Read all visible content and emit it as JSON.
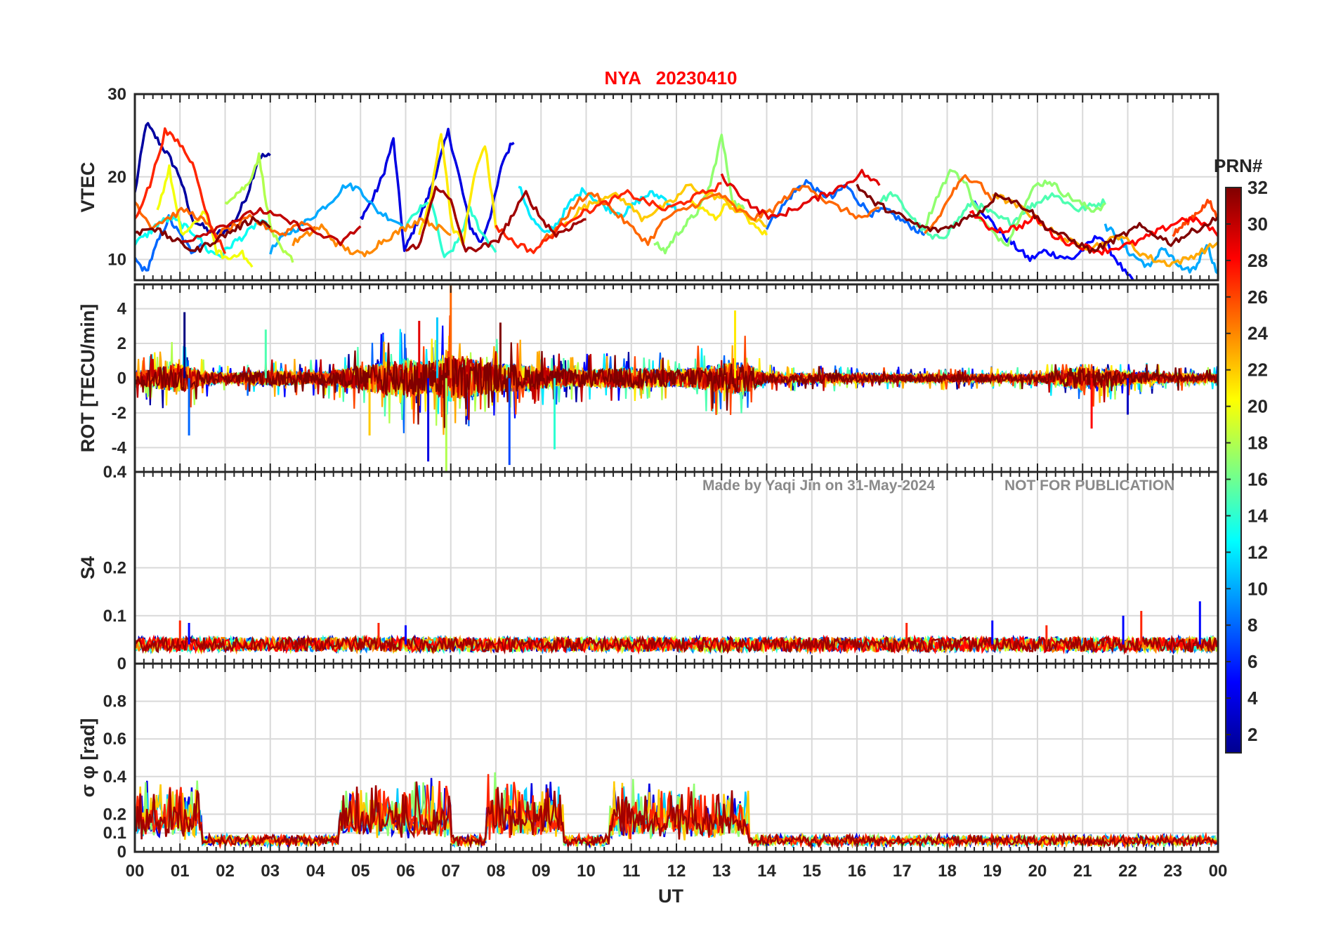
{
  "chart_data": {
    "type": "line",
    "title": "NYA   20230410",
    "watermark": [
      "Made by Yaqi Jin on 31-May-2024",
      "NOT FOR PUBLICATION"
    ],
    "x_axis": {
      "label": "UT",
      "range_hours": [
        0,
        24
      ],
      "tick_labels": [
        "00",
        "01",
        "02",
        "03",
        "04",
        "05",
        "06",
        "07",
        "08",
        "09",
        "10",
        "11",
        "12",
        "13",
        "14",
        "15",
        "16",
        "17",
        "18",
        "19",
        "20",
        "21",
        "22",
        "23",
        "00"
      ]
    },
    "grid": true,
    "colormap": "jet",
    "colorbar": {
      "title": "PRN#",
      "range": [
        1,
        32
      ],
      "tick_labels": [
        "2",
        "4",
        "6",
        "8",
        "10",
        "12",
        "14",
        "16",
        "18",
        "20",
        "22",
        "24",
        "26",
        "28",
        "30",
        "32"
      ],
      "ticks": [
        2,
        4,
        6,
        8,
        10,
        12,
        14,
        16,
        18,
        20,
        22,
        24,
        26,
        28,
        30,
        32
      ]
    },
    "panels": [
      {
        "name": "vtec",
        "ylabel": "VTEC",
        "ylim": [
          7.5,
          30
        ],
        "ytick_labels": [
          "10",
          "20",
          "30"
        ],
        "yticks": [
          10,
          20,
          30
        ],
        "series": [
          {
            "prn": 2,
            "start_h": 0.0,
            "end_h": 3.0,
            "values": [
              18,
              26.5,
              24.5,
              22.5,
              20,
              15,
              14,
              13,
              13.5,
              15,
              18,
              22.5,
              22.5
            ]
          },
          {
            "prn": 4,
            "start_h": 5.0,
            "end_h": 8.4,
            "values": [
              15,
              17,
              20,
              24.5,
              11,
              14,
              17,
              21,
              25.5,
              20,
              14,
              12,
              16,
              22,
              24.5
            ]
          },
          {
            "prn": 5,
            "start_h": 18.6,
            "end_h": 22.3,
            "values": [
              17,
              15,
              13,
              11.5,
              10,
              11,
              10.5,
              10,
              11.5,
              13,
              10.5,
              8,
              6.5
            ]
          },
          {
            "prn": 8,
            "start_h": 0.0,
            "end_h": 1.5,
            "values": [
              10,
              8.5,
              12,
              15,
              13,
              11,
              12
            ]
          },
          {
            "prn": 8,
            "start_h": 14.0,
            "end_h": 17.5,
            "values": [
              14,
              16,
              18,
              19.5,
              18,
              17.5,
              19,
              17,
              15.5,
              16,
              15,
              14,
              13
            ]
          },
          {
            "prn": 10,
            "start_h": 3.0,
            "end_h": 6.0,
            "values": [
              11,
              13,
              14,
              15.5,
              17,
              19,
              18.5,
              16,
              15,
              14
            ]
          },
          {
            "prn": 10,
            "start_h": 21.5,
            "end_h": 24.0,
            "values": [
              14,
              13,
              11,
              10,
              9,
              11.5,
              10,
              8.5,
              9,
              12,
              8
            ]
          },
          {
            "prn": 12,
            "start_h": 8.5,
            "end_h": 12.0,
            "values": [
              19,
              15,
              13,
              14.5,
              17,
              18.5,
              17,
              16,
              15.5,
              17,
              18,
              17.5,
              16
            ]
          },
          {
            "prn": 13,
            "start_h": 0.0,
            "end_h": 3.0,
            "values": [
              12,
              13,
              14.5,
              15,
              14,
              13,
              11,
              10.5,
              12,
              13,
              14.5,
              14
            ]
          },
          {
            "prn": 14,
            "start_h": 6.0,
            "end_h": 8.0,
            "values": [
              14,
              16,
              17,
              10,
              12,
              16,
              13,
              11
            ]
          },
          {
            "prn": 15,
            "start_h": 16.5,
            "end_h": 21.5,
            "values": [
              17,
              18,
              16,
              14,
              12.5,
              13,
              15,
              17,
              16,
              15,
              14.5,
              16,
              17,
              18,
              17,
              16,
              16.5,
              17
            ]
          },
          {
            "prn": 17,
            "start_h": 17.5,
            "end_h": 21.5,
            "values": [
              14,
              18,
              21,
              19,
              15,
              13,
              12,
              16,
              19,
              19.5,
              18,
              17,
              16,
              16.5
            ]
          },
          {
            "prn": 17,
            "start_h": 11.5,
            "end_h": 13.5,
            "values": [
              12,
              11,
              13,
              14.5,
              16,
              19,
              25,
              17,
              16
            ]
          },
          {
            "prn": 18,
            "start_h": 2.0,
            "end_h": 3.5,
            "values": [
              17,
              18,
              19,
              22.5,
              14,
              11,
              10
            ]
          },
          {
            "prn": 20,
            "start_h": 0.5,
            "end_h": 2.6,
            "values": [
              16,
              21,
              13,
              14,
              16,
              11,
              10,
              11,
              9
            ]
          },
          {
            "prn": 21,
            "start_h": 6.3,
            "end_h": 8.0,
            "values": [
              13,
              17,
              25.5,
              14,
              12,
              20,
              24,
              14
            ]
          },
          {
            "prn": 21,
            "start_h": 12.3,
            "end_h": 14.0,
            "values": [
              17,
              16,
              15,
              17,
              16,
              14,
              13
            ]
          },
          {
            "prn": 22,
            "start_h": 9.5,
            "end_h": 14.0,
            "values": [
              14,
              16,
              17,
              18,
              17,
              15,
              16,
              17,
              19,
              18,
              17.5,
              16,
              15,
              14
            ]
          },
          {
            "prn": 23,
            "start_h": 19.0,
            "end_h": 24.0,
            "values": [
              18,
              17,
              16,
              14.5,
              13,
              12,
              11.5,
              12,
              13,
              11,
              10,
              9.5,
              10,
              11,
              12
            ]
          },
          {
            "prn": 24,
            "start_h": 3.5,
            "end_h": 7.0,
            "values": [
              12,
              13,
              14,
              12,
              11,
              10.5,
              12,
              13,
              14,
              15,
              14,
              13
            ]
          },
          {
            "prn": 25,
            "start_h": 0.0,
            "end_h": 4.0,
            "values": [
              17,
              14,
              15,
              16,
              15,
              13,
              14,
              15,
              14,
              13,
              14.5,
              14
            ]
          },
          {
            "prn": 25,
            "start_h": 9.0,
            "end_h": 16.5,
            "values": [
              12,
              14,
              17,
              18,
              16,
              14,
              12,
              15,
              16,
              17,
              18,
              16,
              15,
              16,
              18,
              19,
              17,
              16,
              15,
              16
            ]
          },
          {
            "prn": 25,
            "start_h": 17.5,
            "end_h": 19.0,
            "values": [
              13,
              15,
              18,
              20,
              19.5,
              17
            ]
          },
          {
            "prn": 26,
            "start_h": 23.0,
            "end_h": 24.0,
            "values": [
              13,
              14,
              15,
              16,
              17,
              15
            ]
          },
          {
            "prn": 27,
            "start_h": 0.0,
            "end_h": 2.0,
            "values": [
              15,
              19,
              25.5,
              24,
              21,
              14,
              11
            ]
          },
          {
            "prn": 27,
            "start_h": 8.0,
            "end_h": 13.0,
            "values": [
              14,
              12,
              11,
              13,
              15,
              16,
              17,
              18,
              17,
              16,
              17,
              18,
              19
            ]
          },
          {
            "prn": 28,
            "start_h": 18.5,
            "end_h": 24.0,
            "values": [
              16,
              14,
              13.5,
              14,
              15,
              13,
              12,
              11.5,
              11,
              11.5,
              12,
              13,
              14,
              15,
              14.5,
              13
            ]
          },
          {
            "prn": 29,
            "start_h": 13.0,
            "end_h": 16.5,
            "values": [
              20,
              18,
              16,
              15,
              16,
              17,
              18,
              19,
              20.5,
              19
            ]
          },
          {
            "prn": 30,
            "start_h": 1.0,
            "end_h": 5.0,
            "values": [
              12,
              13,
              14,
              15,
              16,
              15,
              14,
              13,
              12,
              14
            ]
          },
          {
            "prn": 31,
            "start_h": 6.0,
            "end_h": 10.0,
            "values": [
              11,
              12,
              19,
              17,
              11,
              11.5,
              12,
              15,
              18,
              15,
              13,
              14,
              15
            ]
          },
          {
            "prn": 32,
            "start_h": 0.0,
            "end_h": 3.0,
            "values": [
              13,
              14,
              13,
              12,
              11,
              12,
              13,
              14,
              15,
              14
            ]
          },
          {
            "prn": 32,
            "start_h": 16.0,
            "end_h": 24.0,
            "values": [
              19,
              17,
              16,
              15,
              14,
              13.5,
              14,
              15,
              16,
              18,
              17,
              16,
              14,
              13,
              12,
              11,
              12,
              13,
              14,
              13,
              12,
              13,
              14,
              15
            ]
          }
        ]
      },
      {
        "name": "rot",
        "ylabel": "ROT [TECU/min]",
        "ylim": [
          -5.4,
          5.4
        ],
        "ytick_labels": [
          "-4",
          "-2",
          "0",
          "2",
          "4"
        ],
        "yticks": [
          -4,
          -2,
          0,
          2,
          4
        ],
        "envelope": {
          "hours": [
            0,
            0.5,
            1,
            1.5,
            2,
            3,
            4,
            5,
            6,
            6.5,
            7,
            8,
            8.5,
            9,
            10,
            11,
            12,
            13,
            13.5,
            14,
            15,
            16,
            17,
            18,
            19,
            20,
            21,
            22,
            23,
            24
          ],
          "upper": [
            1.5,
            2.2,
            3.5,
            1.5,
            0.9,
            1.8,
            1.5,
            2.6,
            3.2,
            3.5,
            5.6,
            3.0,
            3.2,
            2.2,
            2.0,
            2.5,
            2.0,
            3.5,
            3.8,
            1.0,
            1.2,
            1.0,
            0.9,
            0.8,
            1.0,
            0.8,
            0.8,
            0.8,
            1.0,
            0.9
          ],
          "lower": [
            -1.5,
            -2.6,
            -3.5,
            -1.6,
            -1.2,
            -1.8,
            -1.4,
            -2.8,
            -4.9,
            -3.5,
            -5.4,
            -3.5,
            -3.3,
            -2.6,
            -1.5,
            -1.3,
            -1.5,
            -2.2,
            -2.0,
            -1.2,
            -1.0,
            -0.9,
            -1.0,
            -1.0,
            -1.0,
            -0.9,
            -2.9,
            -1.5,
            -1.1,
            -1.0
          ]
        },
        "spikes": [
          {
            "t": 1.1,
            "v": 3.8
          },
          {
            "t": 1.2,
            "v": -3.3
          },
          {
            "t": 2.9,
            "v": 2.8
          },
          {
            "t": 5.2,
            "v": -3.3
          },
          {
            "t": 6.3,
            "v": 3.3
          },
          {
            "t": 6.5,
            "v": -4.8
          },
          {
            "t": 6.7,
            "v": 3.5
          },
          {
            "t": 6.9,
            "v": -5.4
          },
          {
            "t": 7.0,
            "v": 5.6
          },
          {
            "t": 8.1,
            "v": 3.2
          },
          {
            "t": 8.3,
            "v": -5.0
          },
          {
            "t": 9.3,
            "v": -4.1
          },
          {
            "t": 13.3,
            "v": 3.9
          },
          {
            "t": 21.2,
            "v": -2.9
          },
          {
            "t": 22.0,
            "v": -2.1
          }
        ]
      },
      {
        "name": "s4",
        "ylabel": "S4",
        "ylim": [
          0,
          0.4
        ],
        "ytick_labels": [
          "0",
          "0.1",
          "0.2",
          "0.4"
        ],
        "yticks": [
          0,
          0.1,
          0.2,
          0.4
        ],
        "baseline": 0.04,
        "noise": 0.015,
        "spikes": [
          {
            "t": 1.0,
            "v": 0.09
          },
          {
            "t": 1.2,
            "v": 0.085
          },
          {
            "t": 5.4,
            "v": 0.085
          },
          {
            "t": 6.0,
            "v": 0.08
          },
          {
            "t": 17.1,
            "v": 0.085
          },
          {
            "t": 19.0,
            "v": 0.09
          },
          {
            "t": 20.2,
            "v": 0.08
          },
          {
            "t": 21.9,
            "v": 0.1
          },
          {
            "t": 22.3,
            "v": 0.11
          },
          {
            "t": 23.6,
            "v": 0.13
          }
        ]
      },
      {
        "name": "sigma_phi",
        "ylabel": "σ φ [rad]",
        "ylim": [
          0,
          1.0
        ],
        "ytick_labels": [
          "0",
          "0.1",
          "0.2",
          "0.4",
          "0.6",
          "0.8"
        ],
        "yticks": [
          0,
          0.1,
          0.2,
          0.4,
          0.6,
          0.8
        ],
        "baseline": 0.07,
        "noise": 0.03,
        "bursts": [
          {
            "start_h": 0.0,
            "end_h": 1.5,
            "peak": 0.38
          },
          {
            "start_h": 4.5,
            "end_h": 7.0,
            "peak": 0.38
          },
          {
            "start_h": 7.8,
            "end_h": 9.5,
            "peak": 0.4
          },
          {
            "start_h": 10.5,
            "end_h": 13.6,
            "peak": 0.35
          }
        ]
      }
    ],
    "xlabel": "UT"
  }
}
